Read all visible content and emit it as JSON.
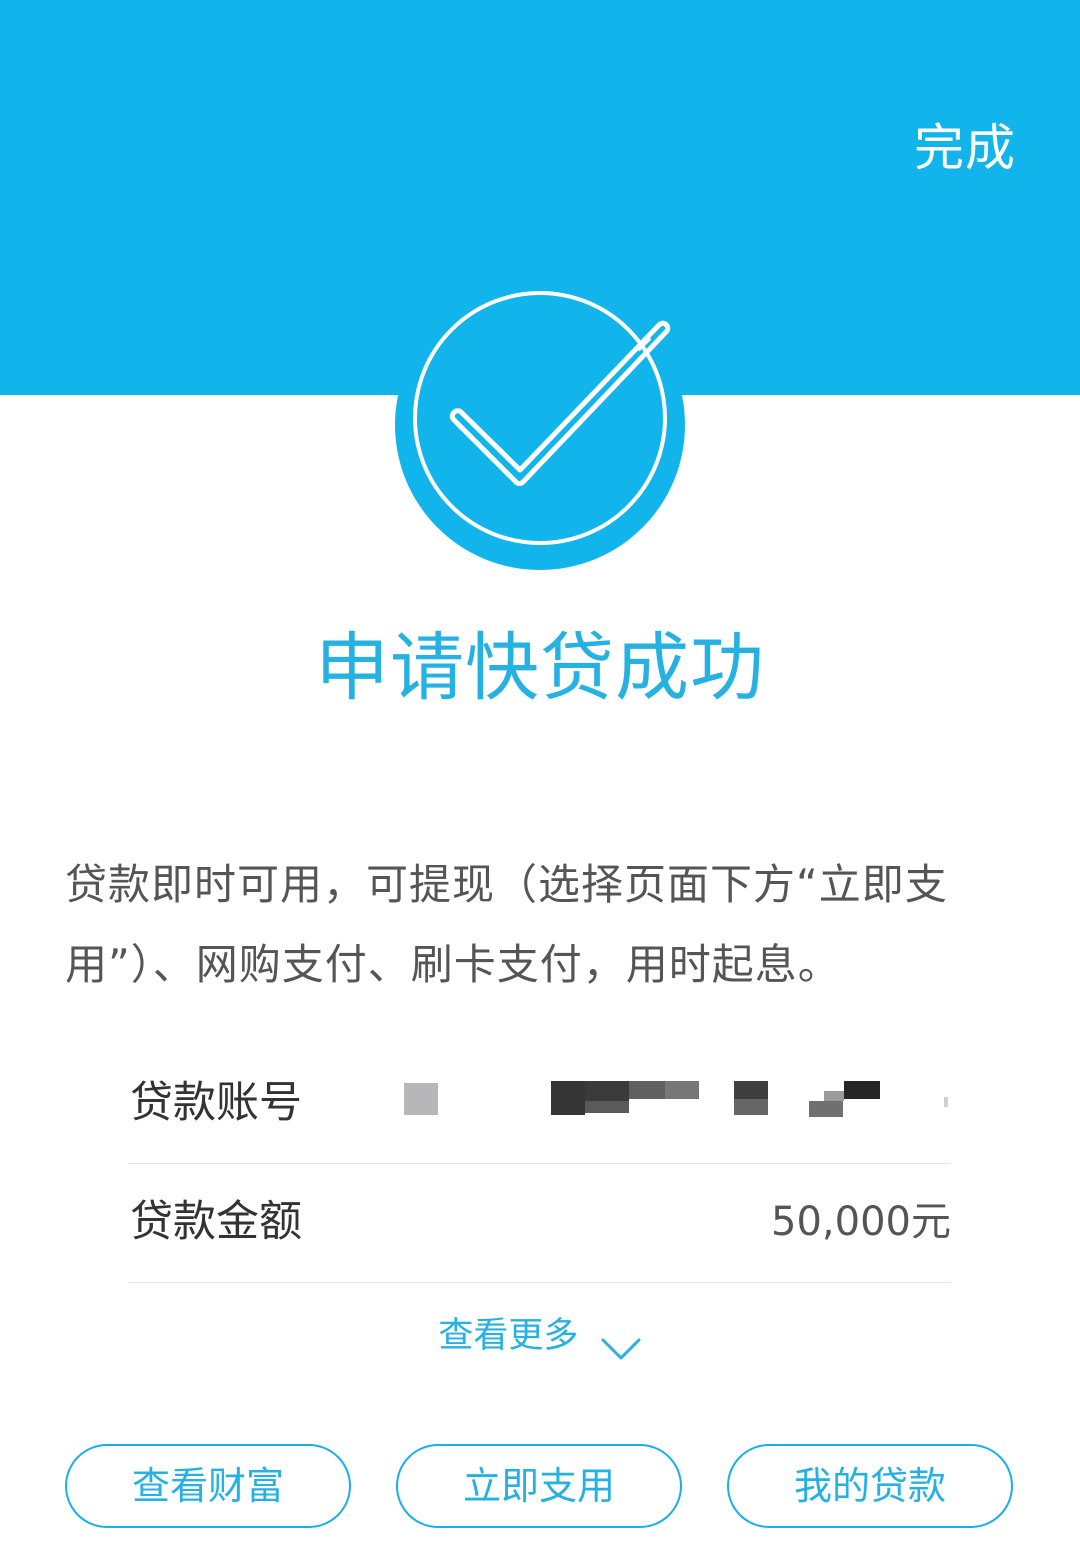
{
  "header": {
    "done_label": "完成",
    "colors": {
      "background": "#12b4ec",
      "text": "#ffffff"
    }
  },
  "success": {
    "icon": "check-circle-icon",
    "title": "申请快贷成功",
    "title_color": "#25b1e2"
  },
  "notice": {
    "lines": [
      "贷款即时可用，可提现（选择页面下方“立即支",
      "用”）、网购支付、刷卡支付，用时起息。"
    ]
  },
  "details": {
    "rows": [
      {
        "label": "贷款账号",
        "value": "",
        "masked": true
      },
      {
        "label": "贷款金额",
        "value": "50,000元",
        "masked": false
      }
    ]
  },
  "more": {
    "label": "查看更多",
    "icon": "chevron-down-icon"
  },
  "actions": [
    {
      "label": "查看财富"
    },
    {
      "label": "立即支用"
    },
    {
      "label": "我的贷款"
    }
  ],
  "colors": {
    "accent": "#25b1e2",
    "button_border": "#19afe8",
    "body_text": "#555555",
    "label_text": "#333333",
    "divider": "#e4e4e4"
  }
}
